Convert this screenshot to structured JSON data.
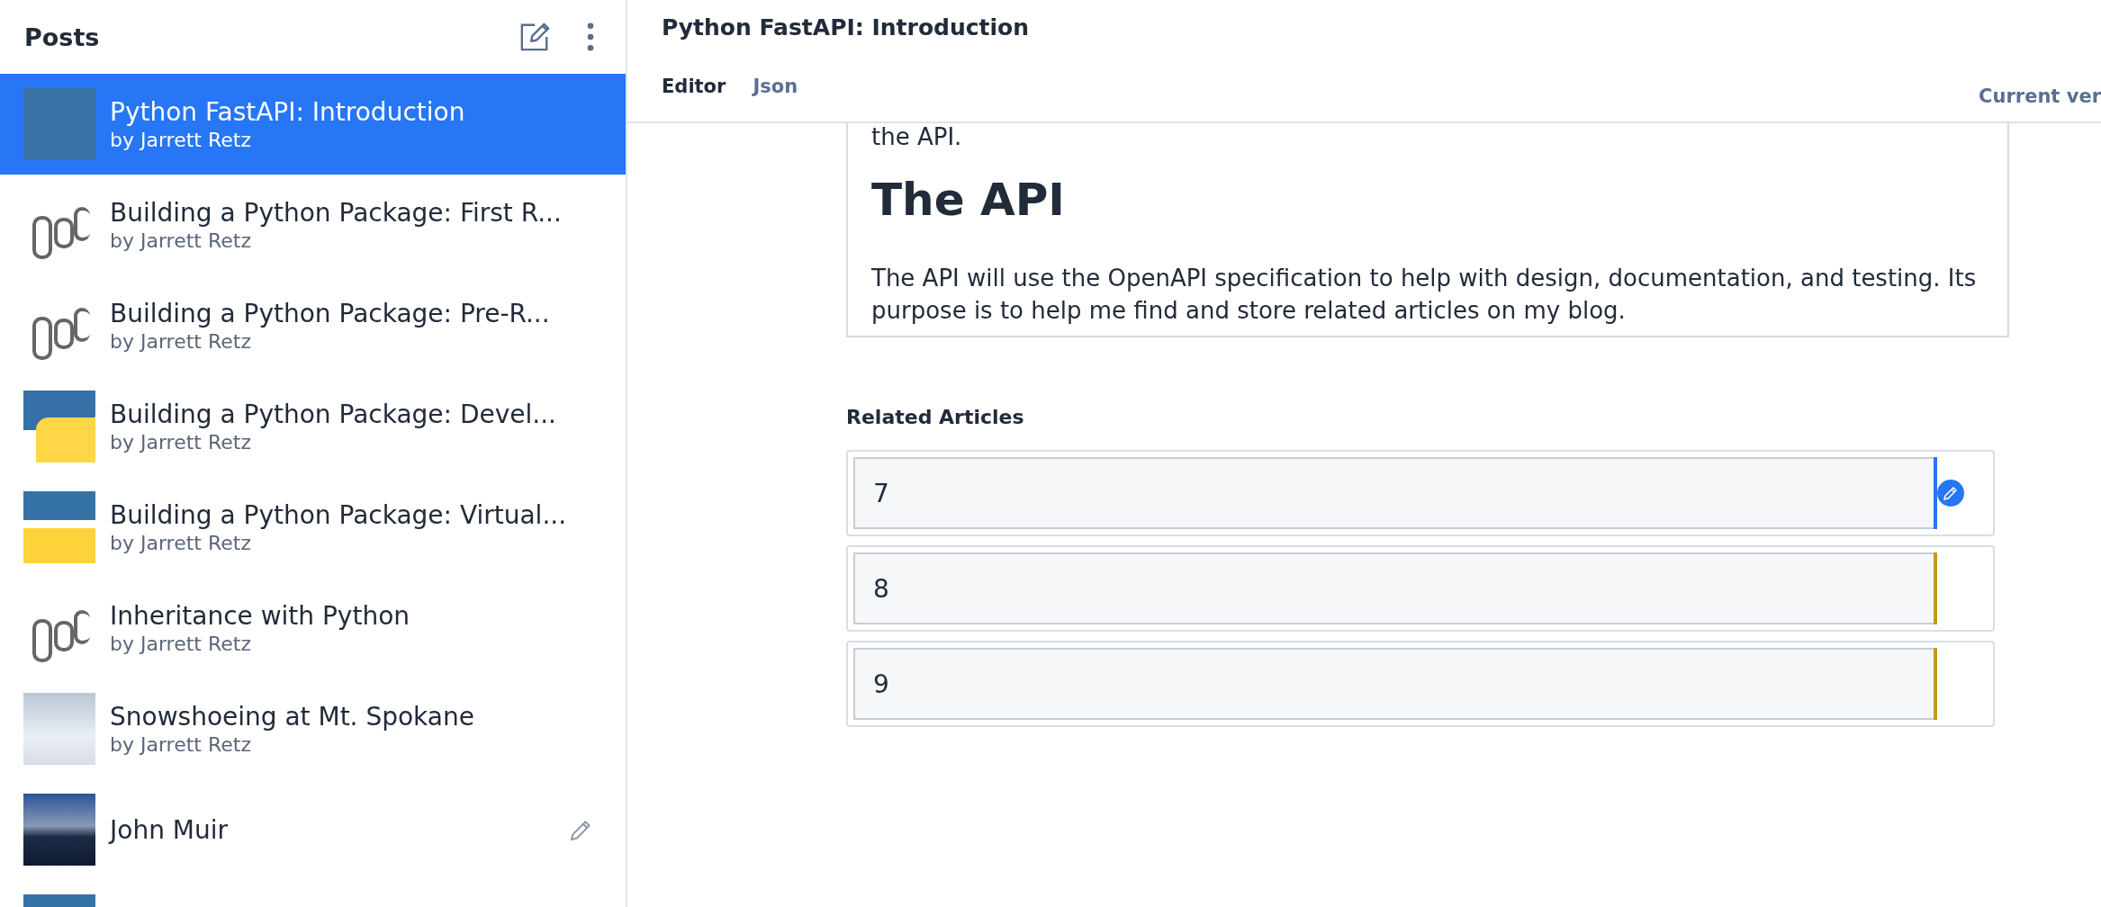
{
  "sidebar": {
    "title": "Posts",
    "posts": [
      {
        "title": "Python FastAPI: Introduction",
        "author": "by Jarrett Retz",
        "kind": "blue-shape",
        "selected": true,
        "editable": false
      },
      {
        "title": "Building a Python Package: First R...",
        "author": "by Jarrett Retz",
        "kind": "wordmark",
        "selected": false,
        "editable": false
      },
      {
        "title": "Building a Python Package: Pre-R...",
        "author": "by Jarrett Retz",
        "kind": "wordmark",
        "selected": false,
        "editable": false
      },
      {
        "title": "Building a Python Package: Devel...",
        "author": "by Jarrett Retz",
        "kind": "logo",
        "selected": false,
        "editable": false
      },
      {
        "title": "Building a Python Package: Virtual...",
        "author": "by Jarrett Retz",
        "kind": "split",
        "selected": false,
        "editable": false
      },
      {
        "title": "Inheritance with Python",
        "author": "by Jarrett Retz",
        "kind": "wordmark",
        "selected": false,
        "editable": false
      },
      {
        "title": "Snowshoeing at Mt. Spokane",
        "author": "by Jarrett Retz",
        "kind": "snow",
        "selected": false,
        "editable": false
      },
      {
        "title": "John Muir",
        "kind": "lake",
        "selected": false,
        "editable": true
      },
      {
        "kind": "split",
        "selected": false,
        "editable": false
      }
    ]
  },
  "document": {
    "title": "Python FastAPI: Introduction",
    "tabs": [
      {
        "label": "Editor",
        "selected": true
      },
      {
        "label": "Json",
        "selected": false
      }
    ],
    "version": "Current ver"
  },
  "body": {
    "lead": "the API.",
    "heading": "The API",
    "paragraph": "The API will use the OpenAPI specification to help with design, documentation, and testing. Its purpose is to help me find and store related articles on my blog."
  },
  "related": {
    "label": "Related Articles",
    "items": [
      {
        "value": "7",
        "active": true
      },
      {
        "value": "8",
        "active": false
      },
      {
        "value": "9",
        "active": false
      }
    ]
  }
}
